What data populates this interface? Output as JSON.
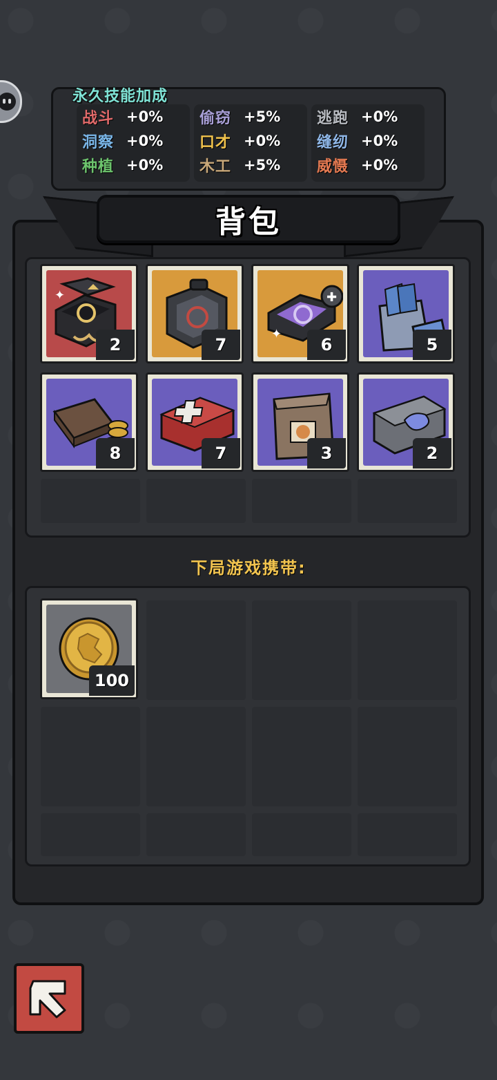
{
  "skills": {
    "title": "永久技能加成",
    "columns": [
      [
        {
          "name": "战斗",
          "value": "+0%",
          "color": "#e26a6a"
        },
        {
          "name": "洞察",
          "value": "+0%",
          "color": "#7ab6e8"
        },
        {
          "name": "种植",
          "value": "+0%",
          "color": "#6dc46d"
        }
      ],
      [
        {
          "name": "偷窃",
          "value": "+5%",
          "color": "#a9a0d8"
        },
        {
          "name": "口才",
          "value": "+0%",
          "color": "#f0c24c"
        },
        {
          "name": "木工",
          "value": "+5%",
          "color": "#c9a879"
        }
      ],
      [
        {
          "name": "逃跑",
          "value": "+0%",
          "color": "#b9bcc2"
        },
        {
          "name": "缝纫",
          "value": "+0%",
          "color": "#8fb7e8"
        },
        {
          "name": "威慑",
          "value": "+0%",
          "color": "#e57a52"
        }
      ]
    ]
  },
  "backpack": {
    "title": "背包",
    "items": [
      {
        "icon": "gift-box-icon",
        "count": "2",
        "bg": "red"
      },
      {
        "icon": "packaged-card-icon",
        "count": "7",
        "bg": "orange"
      },
      {
        "icon": "puzzle-card-icon",
        "count": "6",
        "bg": "orange"
      },
      {
        "icon": "cash-bag-icon",
        "count": "5",
        "bg": "purple"
      },
      {
        "icon": "wallet-coins-icon",
        "count": "8",
        "bg": "purple"
      },
      {
        "icon": "first-aid-kit-icon",
        "count": "7",
        "bg": "purple"
      },
      {
        "icon": "paper-bag-icon",
        "count": "3",
        "bg": "purple"
      },
      {
        "icon": "toolbox-icon",
        "count": "2",
        "bg": "purple"
      }
    ]
  },
  "carry": {
    "label": "下局游戏携带:",
    "items": [
      {
        "icon": "gold-coin-icon",
        "count": "100",
        "bg": "gray"
      }
    ]
  },
  "back_button": {
    "icon": "back-arrow-icon"
  }
}
